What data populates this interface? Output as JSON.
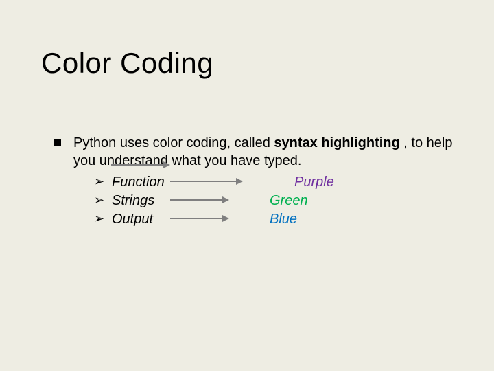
{
  "title": "Color Coding",
  "intro_part1": "Python uses color coding, called ",
  "intro_bold": "syntax highlighting ",
  "intro_part2": ", to help you understand what you have typed.",
  "rows": [
    {
      "chev": "➢",
      "label": "Function",
      "color_label": "Purple",
      "color_class": "c-purple",
      "arrow_class": "arrow-func",
      "pad": "purple-shift"
    },
    {
      "chev": "➢",
      "label": "Strings",
      "color_label": "Green",
      "color_class": "c-green",
      "arrow_class": "arrow-strings",
      "pad": ""
    },
    {
      "chev": "➢",
      "label": "Output",
      "color_label": "Blue",
      "color_class": "c-blue",
      "arrow_class": "arrow-output",
      "pad": ""
    }
  ]
}
